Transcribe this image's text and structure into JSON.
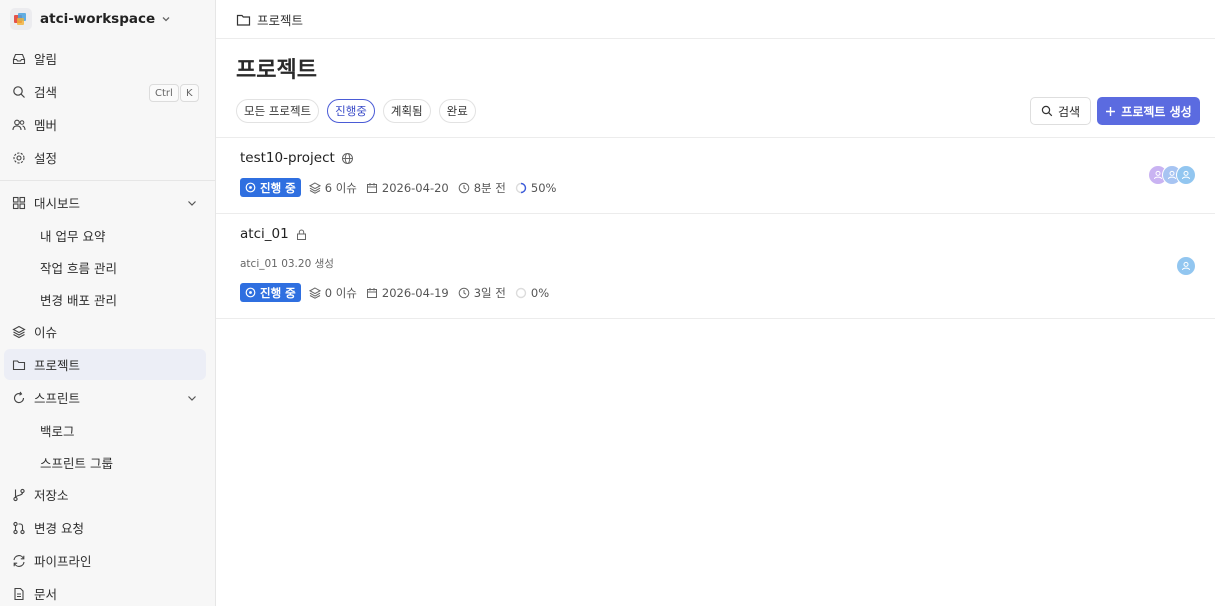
{
  "workspace": {
    "name": "atci-workspace"
  },
  "sidebar": {
    "items": [
      {
        "label": "알림"
      },
      {
        "label": "검색",
        "kbd": [
          "Ctrl",
          "K"
        ]
      },
      {
        "label": "멤버"
      },
      {
        "label": "설정"
      },
      {
        "label": "대시보드"
      },
      {
        "label": "이슈"
      },
      {
        "label": "프로젝트"
      },
      {
        "label": "스프린트"
      },
      {
        "label": "저장소"
      },
      {
        "label": "변경 요청"
      },
      {
        "label": "파이프라인"
      },
      {
        "label": "문서"
      }
    ],
    "dashboard_sub": [
      {
        "label": "내 업무 요약"
      },
      {
        "label": "작업 흐름 관리"
      },
      {
        "label": "변경 배포 관리"
      }
    ],
    "sprint_sub": [
      {
        "label": "백로그"
      },
      {
        "label": "스프린트 그룹"
      }
    ]
  },
  "breadcrumb": {
    "label": "프로젝트"
  },
  "page": {
    "title": "프로젝트"
  },
  "filters": [
    {
      "label": "모든 프로젝트"
    },
    {
      "label": "진행중"
    },
    {
      "label": "계획됨"
    },
    {
      "label": "완료"
    }
  ],
  "actions": {
    "search_label": "검색",
    "create_label": "프로젝트 생성"
  },
  "colors": {
    "accent": "#5b6be0",
    "status_badge": "#2f6fe0"
  },
  "projects": [
    {
      "name": "test10-project",
      "visibility": "public",
      "status": "진행 중",
      "issues": "6 이슈",
      "date": "2026-04-20",
      "updated": "8분 전",
      "progress": "50%",
      "progress_value": 0.5,
      "members": 3
    },
    {
      "name": "atci_01",
      "visibility": "private",
      "desc": "atci_01 03.20 생성",
      "status": "진행 중",
      "issues": "0 이슈",
      "date": "2026-04-19",
      "updated": "3일 전",
      "progress": "0%",
      "progress_value": 0,
      "members": 1
    }
  ]
}
